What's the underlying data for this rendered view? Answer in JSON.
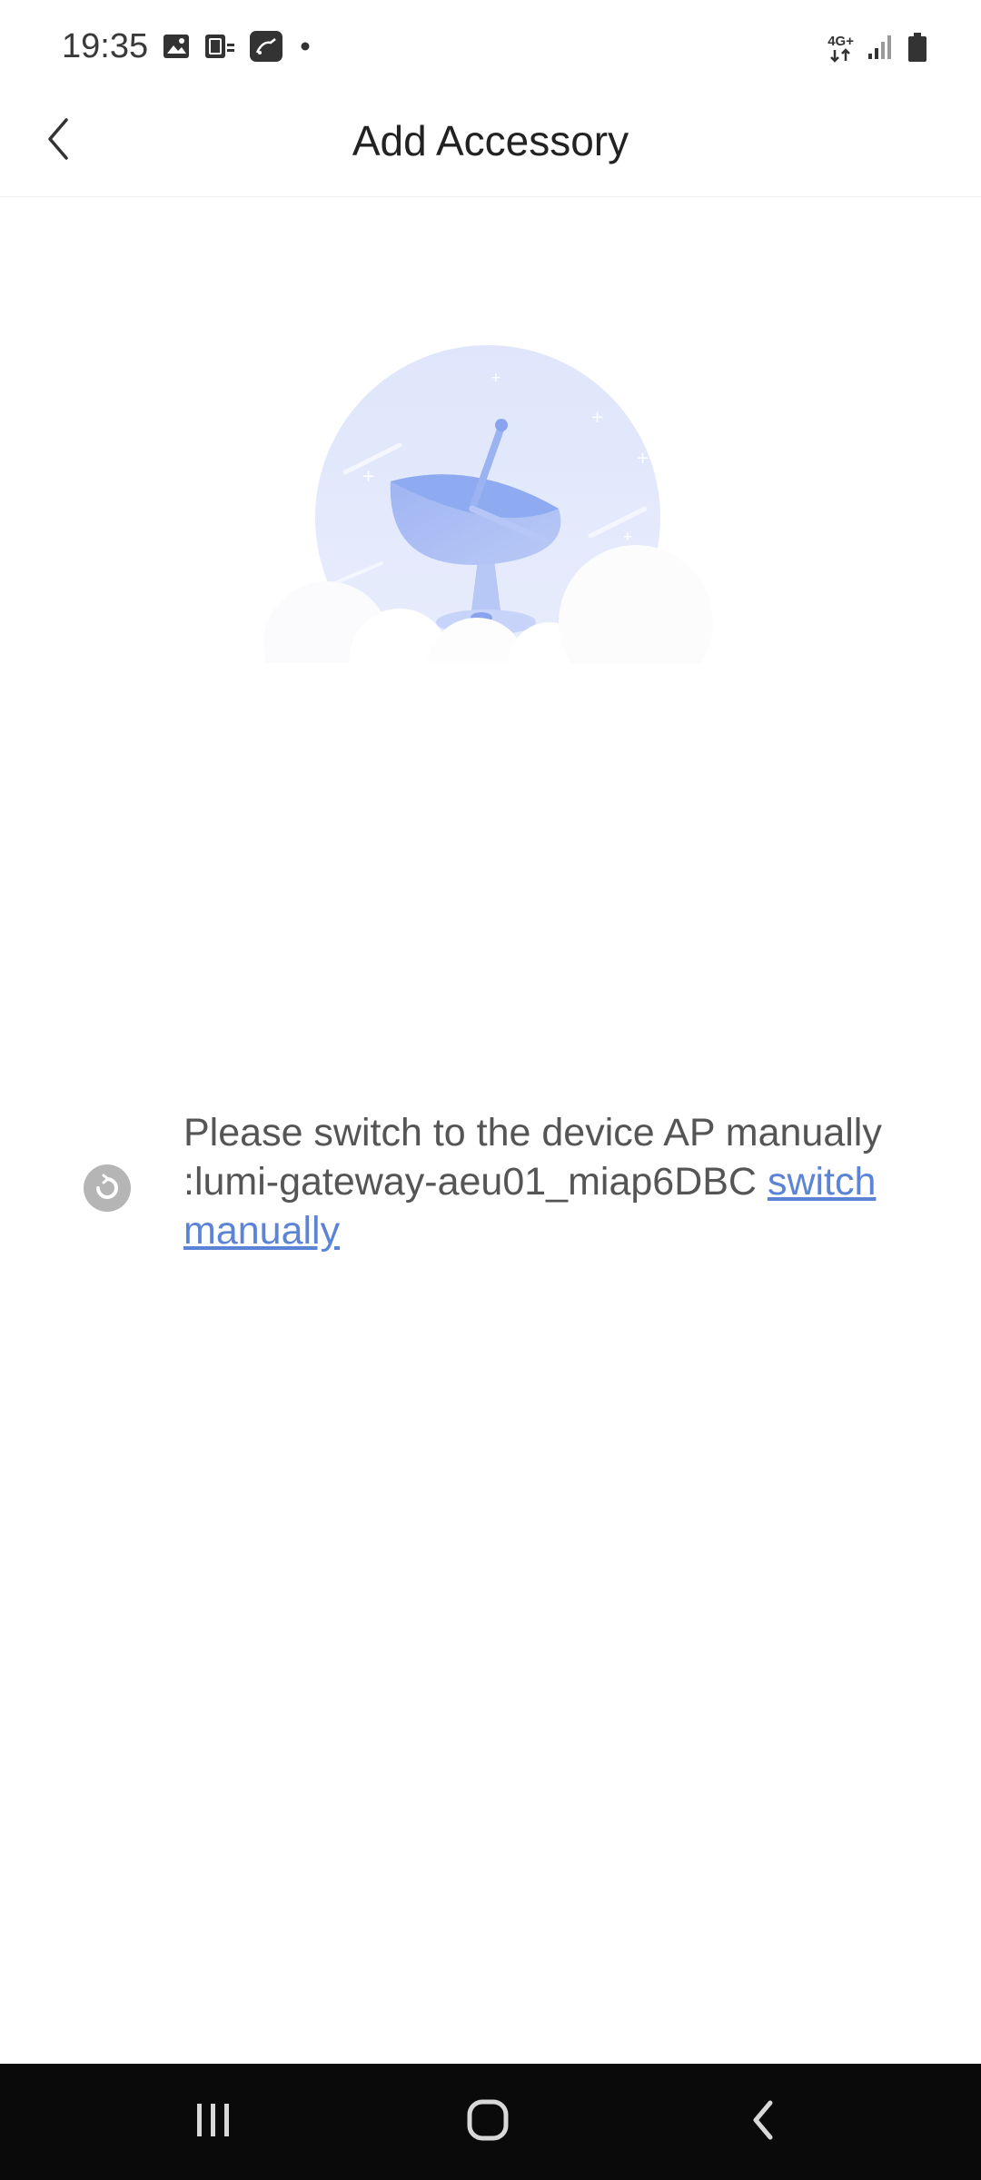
{
  "status_bar": {
    "time": "19:35",
    "network_type": "4G+",
    "left_icons": [
      "gallery-icon",
      "sim-card-icon",
      "cast-icon",
      "dot-icon"
    ],
    "right_icons": [
      "signal-icon",
      "battery-icon"
    ]
  },
  "header": {
    "title": "Add Accessory",
    "back_icon": "chevron-left-icon"
  },
  "illustration": {
    "name": "satellite-dish-illustration",
    "colors": {
      "circle": "#e3e8fb",
      "dish": "#a9bdf3",
      "cloud": "#ffffff"
    }
  },
  "message": {
    "text": "Please switch to the device AP manually :lumi-gateway-aeu01_miap6DBC",
    "link_text": "switch manually",
    "link_color": "#5b83d6",
    "icon": "loading-icon"
  },
  "nav_bar": {
    "buttons": [
      "recent-apps-icon",
      "home-icon",
      "back-icon"
    ]
  }
}
